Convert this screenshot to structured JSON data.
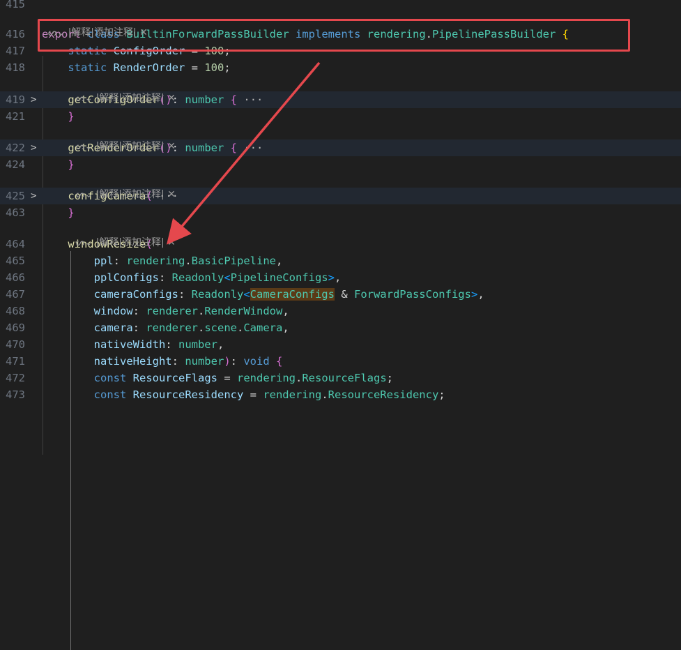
{
  "lens": {
    "label": "|解释|添加注释|",
    "icon": "code-lens-icon",
    "close_icon": "close-icon"
  },
  "lines": [
    {
      "no": "415",
      "fold": "",
      "hl": false,
      "tokens": []
    },
    {
      "no": "416",
      "fold": "",
      "hl": false,
      "tokens": [
        {
          "t": "export",
          "c": "t-kw2"
        },
        {
          "t": " "
        },
        {
          "t": "class",
          "c": "t-kw"
        },
        {
          "t": " "
        },
        {
          "t": "BuiltinForwardPassBuilder",
          "c": "t-cls"
        },
        {
          "t": " "
        },
        {
          "t": "implements",
          "c": "t-kw"
        },
        {
          "t": " "
        },
        {
          "t": "rendering",
          "c": "t-cls"
        },
        {
          "t": ".",
          "c": "t-plain"
        },
        {
          "t": "PipelinePassBuilder",
          "c": "t-cls"
        },
        {
          "t": " "
        },
        {
          "t": "{",
          "c": "t-p1"
        }
      ]
    },
    {
      "no": "417",
      "fold": "",
      "hl": false,
      "tokens": [
        {
          "t": "    "
        },
        {
          "t": "static",
          "c": "t-kw"
        },
        {
          "t": " "
        },
        {
          "t": "ConfigOrder",
          "c": "t-var"
        },
        {
          "t": " = ",
          "c": "t-plain"
        },
        {
          "t": "100",
          "c": "t-num"
        },
        {
          "t": ";",
          "c": "t-plain"
        }
      ]
    },
    {
      "no": "418",
      "fold": "",
      "hl": false,
      "tokens": [
        {
          "t": "    "
        },
        {
          "t": "static",
          "c": "t-kw"
        },
        {
          "t": " "
        },
        {
          "t": "RenderOrder",
          "c": "t-var"
        },
        {
          "t": " = ",
          "c": "t-plain"
        },
        {
          "t": "100",
          "c": "t-num"
        },
        {
          "t": ";",
          "c": "t-plain"
        }
      ]
    },
    {
      "no": "419",
      "fold": ">",
      "hl": true,
      "tokens": [
        {
          "t": "    "
        },
        {
          "t": "getConfigOrder",
          "c": "t-fn"
        },
        {
          "t": "()",
          "c": "t-p2"
        },
        {
          "t": ": ",
          "c": "t-plain"
        },
        {
          "t": "number",
          "c": "t-cls"
        },
        {
          "t": " "
        },
        {
          "t": "{",
          "c": "t-p2"
        },
        {
          "t": " "
        },
        {
          "t": "···",
          "c": "t-ell"
        }
      ]
    },
    {
      "no": "421",
      "fold": "",
      "hl": false,
      "tokens": [
        {
          "t": "    "
        },
        {
          "t": "}",
          "c": "t-p2"
        }
      ]
    },
    {
      "no": "422",
      "fold": ">",
      "hl": true,
      "tokens": [
        {
          "t": "    "
        },
        {
          "t": "getRenderOrder",
          "c": "t-fn"
        },
        {
          "t": "()",
          "c": "t-p2"
        },
        {
          "t": ": ",
          "c": "t-plain"
        },
        {
          "t": "number",
          "c": "t-cls"
        },
        {
          "t": " "
        },
        {
          "t": "{",
          "c": "t-p2"
        },
        {
          "t": " "
        },
        {
          "t": "···",
          "c": "t-ell"
        }
      ]
    },
    {
      "no": "424",
      "fold": "",
      "hl": false,
      "tokens": [
        {
          "t": "    "
        },
        {
          "t": "}",
          "c": "t-p2"
        }
      ]
    },
    {
      "no": "425",
      "fold": ">",
      "hl": true,
      "tokens": [
        {
          "t": "    "
        },
        {
          "t": "configCamera",
          "c": "t-fn"
        },
        {
          "t": "(",
          "c": "t-p2"
        },
        {
          "t": " "
        },
        {
          "t": "···",
          "c": "t-ell"
        }
      ]
    },
    {
      "no": "463",
      "fold": "",
      "hl": false,
      "tokens": [
        {
          "t": "    "
        },
        {
          "t": "}",
          "c": "t-p2"
        }
      ]
    },
    {
      "no": "464",
      "fold": "",
      "hl": false,
      "tokens": [
        {
          "t": "    "
        },
        {
          "t": "windowResize",
          "c": "t-fn"
        },
        {
          "t": "(",
          "c": "t-p2"
        }
      ]
    },
    {
      "no": "465",
      "fold": "",
      "hl": false,
      "tokens": [
        {
          "t": "        "
        },
        {
          "t": "ppl",
          "c": "t-var"
        },
        {
          "t": ": ",
          "c": "t-plain"
        },
        {
          "t": "rendering",
          "c": "t-cls"
        },
        {
          "t": ".",
          "c": "t-plain"
        },
        {
          "t": "BasicPipeline",
          "c": "t-cls"
        },
        {
          "t": ",",
          "c": "t-plain"
        }
      ]
    },
    {
      "no": "466",
      "fold": "",
      "hl": false,
      "tokens": [
        {
          "t": "        "
        },
        {
          "t": "pplConfigs",
          "c": "t-var"
        },
        {
          "t": ": ",
          "c": "t-plain"
        },
        {
          "t": "Readonly",
          "c": "t-cls"
        },
        {
          "t": "<",
          "c": "t-p3"
        },
        {
          "t": "PipelineConfigs",
          "c": "t-cls"
        },
        {
          "t": ">",
          "c": "t-p3"
        },
        {
          "t": ",",
          "c": "t-plain"
        }
      ]
    },
    {
      "no": "467",
      "fold": "",
      "hl": false,
      "tokens": [
        {
          "t": "        "
        },
        {
          "t": "cameraConfigs",
          "c": "t-var"
        },
        {
          "t": ": ",
          "c": "t-plain"
        },
        {
          "t": "Readonly",
          "c": "t-cls"
        },
        {
          "t": "<",
          "c": "t-p3"
        },
        {
          "t": "CameraConfigs",
          "c": "t-mark"
        },
        {
          "t": " & ",
          "c": "t-plain"
        },
        {
          "t": "ForwardPassConfigs",
          "c": "t-cls"
        },
        {
          "t": ">",
          "c": "t-p3"
        },
        {
          "t": ",",
          "c": "t-plain"
        }
      ]
    },
    {
      "no": "468",
      "fold": "",
      "hl": false,
      "tokens": [
        {
          "t": "        "
        },
        {
          "t": "window",
          "c": "t-var"
        },
        {
          "t": ": ",
          "c": "t-plain"
        },
        {
          "t": "renderer",
          "c": "t-cls"
        },
        {
          "t": ".",
          "c": "t-plain"
        },
        {
          "t": "RenderWindow",
          "c": "t-cls"
        },
        {
          "t": ",",
          "c": "t-plain"
        }
      ]
    },
    {
      "no": "469",
      "fold": "",
      "hl": false,
      "tokens": [
        {
          "t": "        "
        },
        {
          "t": "camera",
          "c": "t-var"
        },
        {
          "t": ": ",
          "c": "t-plain"
        },
        {
          "t": "renderer",
          "c": "t-cls"
        },
        {
          "t": ".",
          "c": "t-plain"
        },
        {
          "t": "scene",
          "c": "t-cls"
        },
        {
          "t": ".",
          "c": "t-plain"
        },
        {
          "t": "Camera",
          "c": "t-cls"
        },
        {
          "t": ",",
          "c": "t-plain"
        }
      ]
    },
    {
      "no": "470",
      "fold": "",
      "hl": false,
      "tokens": [
        {
          "t": "        "
        },
        {
          "t": "nativeWidth",
          "c": "t-var"
        },
        {
          "t": ": ",
          "c": "t-plain"
        },
        {
          "t": "number",
          "c": "t-cls"
        },
        {
          "t": ",",
          "c": "t-plain"
        }
      ]
    },
    {
      "no": "471",
      "fold": "",
      "hl": false,
      "tokens": [
        {
          "t": "        "
        },
        {
          "t": "nativeHeight",
          "c": "t-var"
        },
        {
          "t": ": ",
          "c": "t-plain"
        },
        {
          "t": "number",
          "c": "t-cls"
        },
        {
          "t": ")",
          "c": "t-p2"
        },
        {
          "t": ": ",
          "c": "t-plain"
        },
        {
          "t": "void",
          "c": "t-kw"
        },
        {
          "t": " "
        },
        {
          "t": "{",
          "c": "t-p2"
        }
      ]
    },
    {
      "no": "472",
      "fold": "",
      "hl": false,
      "tokens": [
        {
          "t": "        "
        },
        {
          "t": "const",
          "c": "t-kw"
        },
        {
          "t": " "
        },
        {
          "t": "ResourceFlags",
          "c": "t-var"
        },
        {
          "t": " = ",
          "c": "t-plain"
        },
        {
          "t": "rendering",
          "c": "t-cls"
        },
        {
          "t": ".",
          "c": "t-plain"
        },
        {
          "t": "ResourceFlags",
          "c": "t-cls"
        },
        {
          "t": ";",
          "c": "t-plain"
        }
      ]
    },
    {
      "no": "473",
      "fold": "",
      "hl": false,
      "tokens": [
        {
          "t": "        "
        },
        {
          "t": "const",
          "c": "t-kw"
        },
        {
          "t": " "
        },
        {
          "t": "ResourceResidency",
          "c": "t-var"
        },
        {
          "t": " = ",
          "c": "t-plain"
        },
        {
          "t": "rendering",
          "c": "t-cls"
        },
        {
          "t": ".",
          "c": "t-plain"
        },
        {
          "t": "ResourceResidency",
          "c": "t-cls"
        },
        {
          "t": ";",
          "c": "t-plain"
        }
      ]
    }
  ]
}
